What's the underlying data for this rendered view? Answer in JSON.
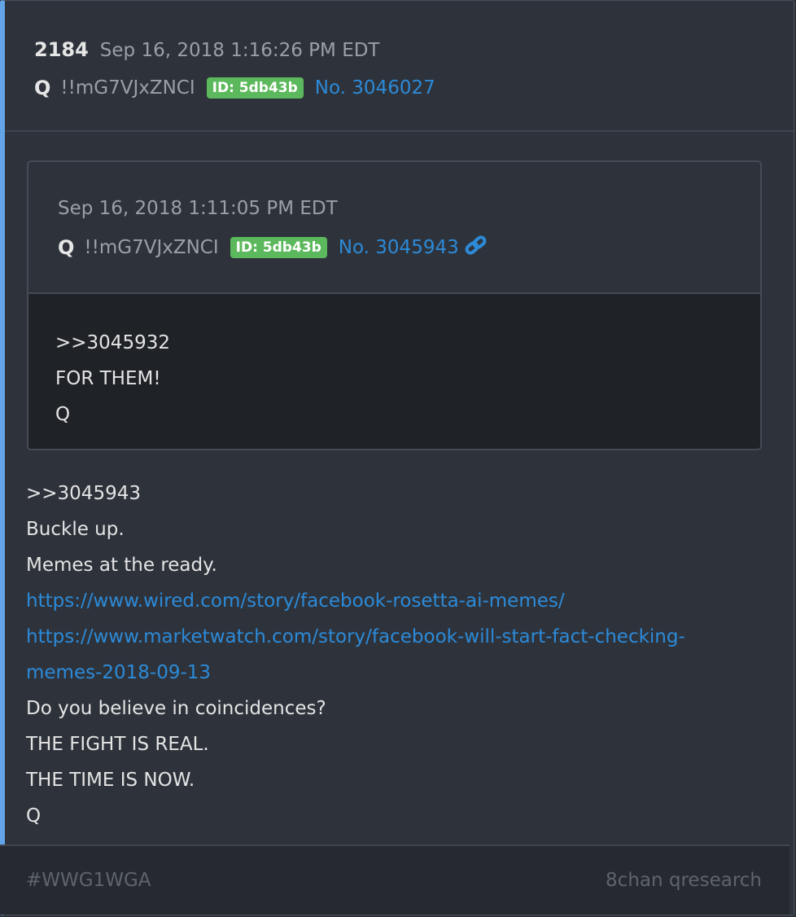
{
  "post": {
    "number": "2184",
    "date": "Sep 16, 2018 1:16:26 PM EDT",
    "author": "Q",
    "tripcode": "!!mG7VJxZNCI",
    "id_badge": "ID: 5db43b",
    "post_link": "No. 3046027"
  },
  "quoted_post": {
    "date": "Sep 16, 2018 1:11:05 PM EDT",
    "author": "Q",
    "tripcode": "!!mG7VJxZNCI",
    "id_badge": "ID: 5db43b",
    "post_link": "No. 3045943",
    "lines": [
      ">>3045932",
      "FOR THEM!",
      "Q"
    ]
  },
  "body": {
    "line1": ">>3045943",
    "line2": "Buckle up.",
    "line3": "Memes at the ready.",
    "link1": "https://www.wired.com/story/facebook-rosetta-ai-memes/",
    "link2a": "https://www.marketwatch.com/story/facebook-will-start-fact-checking-",
    "link2b": "memes-2018-09-13",
    "line4": "Do you believe in coincidences?",
    "line5": "THE FIGHT IS REAL.",
    "line6": "THE TIME IS NOW.",
    "line7": "Q"
  },
  "footer": {
    "hashtag": "#WWG1WGA",
    "source": "8chan qresearch"
  },
  "colors": {
    "accent": "#63a4e8",
    "link": "#2c8ad8",
    "badge": "#5cb85c"
  },
  "icons": {
    "permalink": "link-icon"
  }
}
